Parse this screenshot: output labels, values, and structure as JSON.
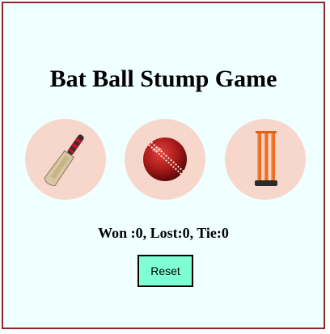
{
  "game": {
    "title": "Bat Ball Stump Game",
    "choices": [
      {
        "name": "bat",
        "icon": "cricket-bat-icon"
      },
      {
        "name": "ball",
        "icon": "cricket-ball-icon"
      },
      {
        "name": "stump",
        "icon": "cricket-stumps-icon"
      }
    ],
    "score_text": "Won :0, Lost:0, Tie:0",
    "reset_label": "Reset"
  },
  "colors": {
    "frame_border": "#8b2a2a",
    "page_background": "#f0ffff",
    "choice_background": "#f7d6cb",
    "reset_background": "#7fffd4"
  }
}
